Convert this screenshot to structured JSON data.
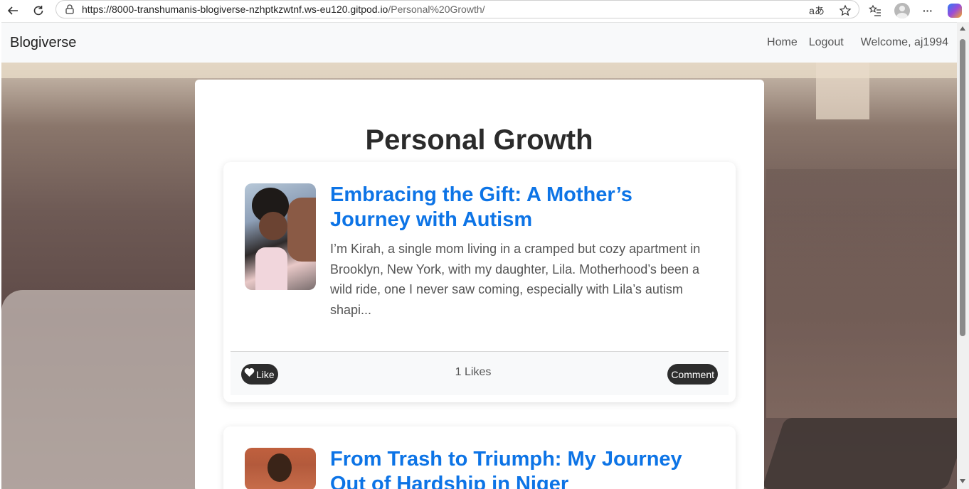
{
  "browser": {
    "url_host": "https://8000-transhumanis-blogiverse-nzhptkzwtnf.ws-eu120.gitpod.io",
    "url_path": "/Personal%20Growth/",
    "icons": [
      "back-icon",
      "reload-icon",
      "lock-icon",
      "translate-icon",
      "star-icon",
      "favorites-icon",
      "profile-icon",
      "more-icon",
      "copilot-icon"
    ],
    "translate_glyph": "aあ",
    "more_glyph": "···"
  },
  "navbar": {
    "brand": "Blogiverse",
    "home": "Home",
    "logout": "Logout",
    "welcome": "Welcome, aj1994"
  },
  "page": {
    "title": "Personal Growth"
  },
  "posts": [
    {
      "title": "Embracing the Gift: A Mother’s Journey with Autism",
      "excerpt": "I’m Kirah, a single mom living in a cramped but cozy apartment in Brooklyn, New York, with my daughter, Lila. Motherhood’s been a wild ride, one I never saw coming, especially with Lila’s autism shapi...",
      "like_label": "Like",
      "likes": "1 Likes",
      "comment_label": "Comment"
    },
    {
      "title": "From Trash to Triumph: My Journey Out of Hardship in Niger"
    }
  ]
}
